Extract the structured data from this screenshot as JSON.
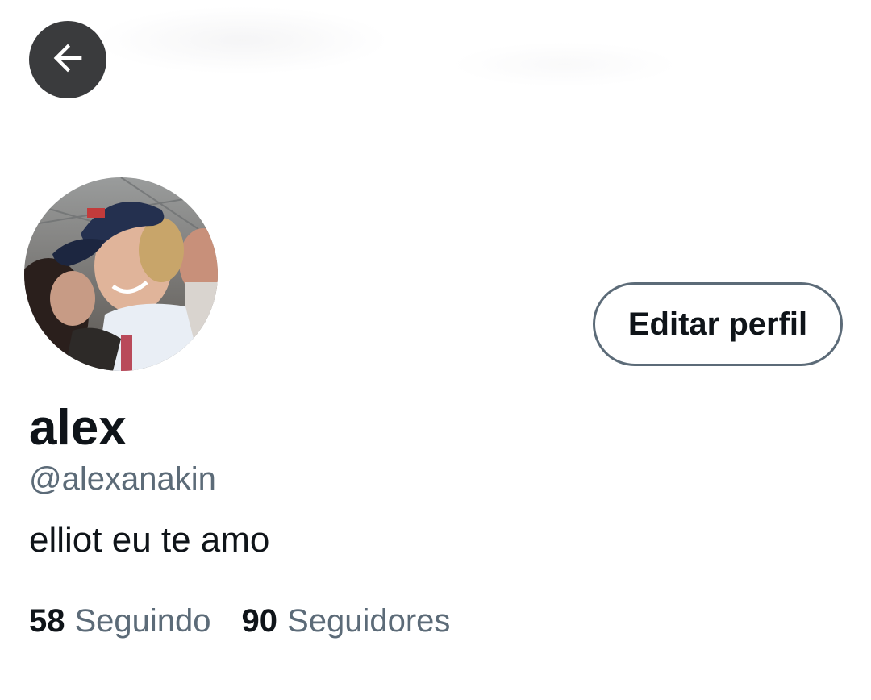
{
  "header": {
    "back_icon": "arrow-left-icon"
  },
  "profile": {
    "display_name": "alex",
    "handle": "@alexanakin",
    "bio": "elliot eu te amo",
    "edit_button_label": "Editar perfil"
  },
  "stats": {
    "following_count": "58",
    "following_label": "Seguindo",
    "followers_count": "90",
    "followers_label": "Seguidores"
  },
  "colors": {
    "text_primary": "#0f1419",
    "text_secondary": "#5c6b78",
    "back_button_bg": "#3a3b3d"
  }
}
